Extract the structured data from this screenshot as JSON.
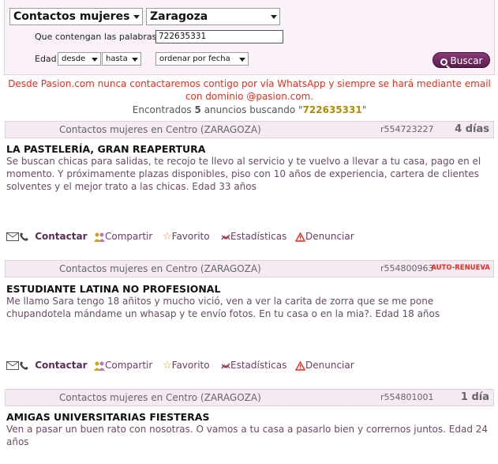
{
  "search": {
    "category": "Contactos mujeres",
    "city": "Zaragoza",
    "words_label": "Que contengan las palabras",
    "words_value": "722635331",
    "age_label": "Edad",
    "from": "desde",
    "to": "hasta",
    "order": "ordenar por fecha",
    "search_button": "Buscar"
  },
  "warning": "Desde Pasion.com nunca contactaremos contigo por vía WhatsApp y siempre se hará mediante email con dominio @pasion.com.",
  "results": {
    "prefix": "Encontrados",
    "count": "5",
    "middle": "anuncios buscando \"",
    "term": "722635331",
    "suffix": "\""
  },
  "action_labels": {
    "contact": "Contactar",
    "share": "Compartir",
    "favorite": "Favorito",
    "stats": "Estadísticas",
    "report": "Denunciar"
  },
  "listings": [
    {
      "category": "Contactos mujeres en Centro (ZARAGOZA)",
      "ref": "r554723227",
      "age": "4 días",
      "renew": "",
      "title": "LA PASTELERÍA, GRAN REAPERTURA",
      "desc": "Se buscan chicas para salidas, te recojo te llevo al servicio y te vuelvo a llevar a tu casa, pago en el momento. Y próximamente plazas disponibles, piso con 10 años de experiencia, cartera de clientes solventes y el mejor trato a las chicas. Edad 33 años"
    },
    {
      "category": "Contactos mujeres en Centro (ZARAGOZA)",
      "ref": "r554800963",
      "age": "",
      "renew": "AUTO-RENUEVA",
      "title": "ESTUDIANTE LATINA NO PROFESIONAL",
      "desc": "Me llamo Sara tengo 18 añitos y mucho vició, ven a ver la carita de zorra que se me pone chupandotela mándame un whasap y te envío fotos. En tu casa o en la mia?. Edad 18 años"
    },
    {
      "category": "Contactos mujeres en Centro (ZARAGOZA)",
      "ref": "r554801001",
      "age": "1 día",
      "renew": "",
      "title": "AMIGAS UNIVERSITARIAS FIESTERAS",
      "desc": "Ven a pasar un buen rato con nosotras. O vamos a tu casa a pasarlo bien y corrernos juntos. Edad 24 años"
    }
  ]
}
